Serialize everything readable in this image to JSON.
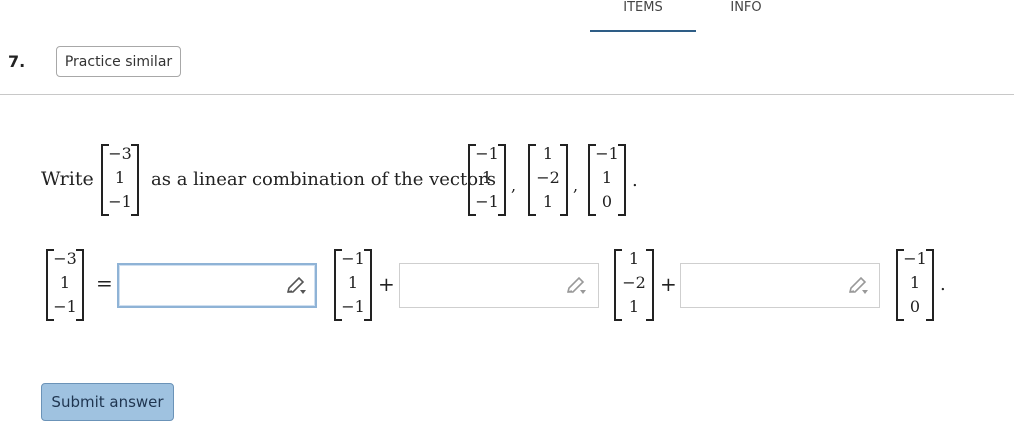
{
  "tabs": {
    "items": "ITEMS",
    "info": "INFO"
  },
  "question": {
    "number": "7.",
    "practice_label": "Practice similar"
  },
  "prompt": {
    "write": "Write",
    "target": [
      "−3",
      "1",
      "−1"
    ],
    "middle": "as a linear combination of the vectors",
    "vectors": [
      [
        "−1",
        "1",
        "−1"
      ],
      [
        "1",
        "−2",
        "1"
      ],
      [
        "−1",
        "1",
        "0"
      ]
    ],
    "comma": ",",
    "period": "."
  },
  "equation": {
    "lhs": [
      "−3",
      "1",
      "−1"
    ],
    "equals": "=",
    "plus": "+",
    "period": ".",
    "inputs": [
      {
        "value": "",
        "active": true
      },
      {
        "value": "",
        "active": false
      },
      {
        "value": "",
        "active": false
      }
    ],
    "vectors": [
      [
        "−1",
        "1",
        "−1"
      ],
      [
        "1",
        "−2",
        "1"
      ],
      [
        "−1",
        "1",
        "0"
      ]
    ]
  },
  "submit_label": "Submit answer",
  "colors": {
    "tab_underline": "#2e5d86",
    "submit_bg": "#9fc2e0",
    "active_input_border": "#8fb3d6"
  }
}
